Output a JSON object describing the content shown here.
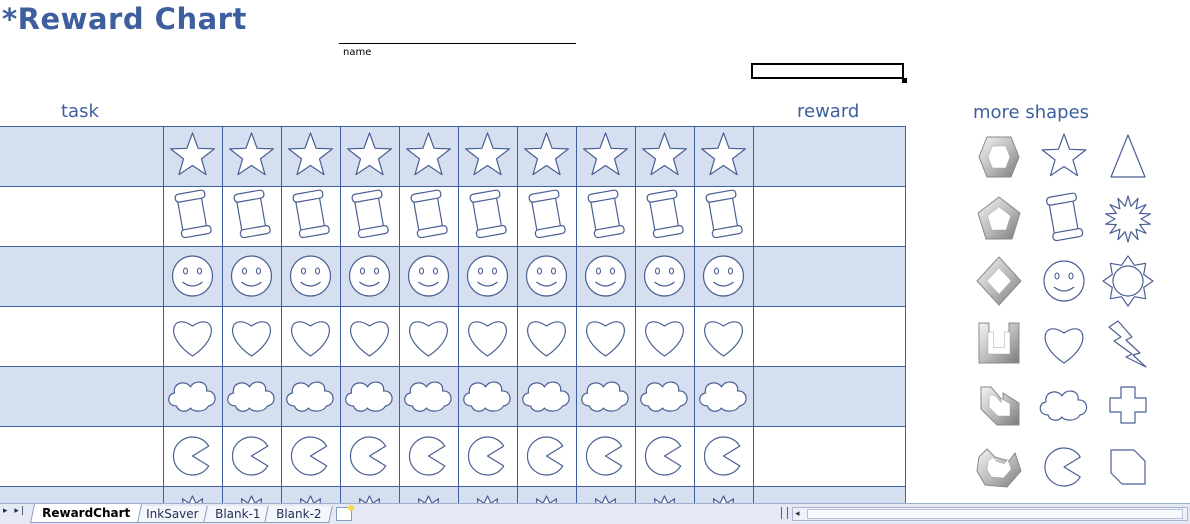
{
  "title": "*Reward Chart",
  "name_label": "name",
  "headers": {
    "task": "task",
    "reward": "reward",
    "more_shapes": "more shapes"
  },
  "grid": {
    "row_shapes": [
      "star",
      "scroll",
      "smiley",
      "heart",
      "cloud",
      "pacman",
      "burst"
    ],
    "day_columns": 10,
    "shaded_row_color": "#d5dff0",
    "line_color": "#3e5f9e"
  },
  "more_shapes": [
    [
      "bevel-hexagon",
      "star",
      "triangle"
    ],
    [
      "bevel-pentagon",
      "scroll",
      "starburst"
    ],
    [
      "bevel-diamond",
      "smiley",
      "sun"
    ],
    [
      "bevel-u",
      "heart",
      "lightning"
    ],
    [
      "bevel-hook",
      "cloud",
      "cross"
    ],
    [
      "bevel-arc",
      "pacman",
      "snipped-rect"
    ]
  ],
  "sheet_tabs": [
    {
      "label": "RewardChart",
      "active": true
    },
    {
      "label": "InkSaver",
      "active": false
    },
    {
      "label": "Blank-1",
      "active": false
    },
    {
      "label": "Blank-2",
      "active": false
    }
  ],
  "sheet_nav": {
    "last_arrows": "▸ ▸|"
  },
  "colors": {
    "title": "#3e5f9e",
    "shape_stroke": "#4a5f93"
  }
}
